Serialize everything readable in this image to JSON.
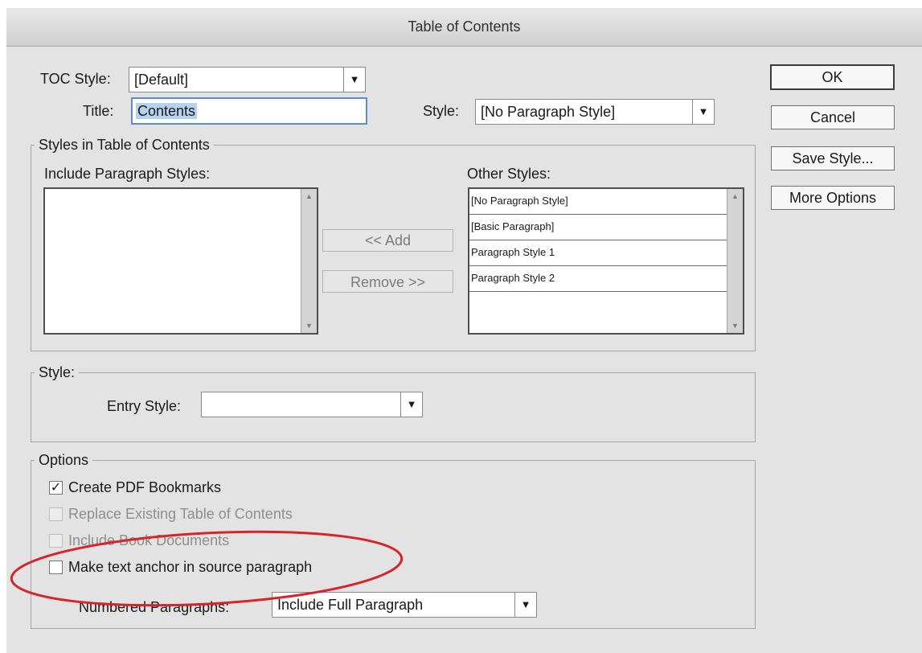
{
  "dialog": {
    "title": "Table of Contents"
  },
  "toc_style": {
    "label": "TOC Style:",
    "value": "[Default]"
  },
  "title_field": {
    "label": "Title:",
    "value": "Contents"
  },
  "title_style": {
    "label": "Style:",
    "value": "[No Paragraph Style]"
  },
  "styles_group": {
    "title": "Styles in Table of Contents",
    "include_label": "Include Paragraph Styles:",
    "include_items": [],
    "other_label": "Other Styles:",
    "other_items": [
      "[No Paragraph Style]",
      "[Basic Paragraph]",
      "Paragraph Style 1",
      "Paragraph Style 2"
    ],
    "add_button": "<< Add",
    "remove_button": "Remove >>"
  },
  "style_group": {
    "title": "Style:",
    "entry_style_label": "Entry Style:",
    "entry_style_value": ""
  },
  "options_group": {
    "title": "Options",
    "create_pdf_bookmarks": {
      "label": "Create PDF Bookmarks",
      "checked": true,
      "enabled": true
    },
    "replace_existing": {
      "label": "Replace Existing Table of Contents",
      "checked": false,
      "enabled": false
    },
    "include_book_docs": {
      "label": "Include Book Documents",
      "checked": false,
      "enabled": false
    },
    "make_text_anchor": {
      "label": "Make text anchor in source paragraph",
      "checked": false,
      "enabled": true
    },
    "numbered_paragraphs_label": "Numbered Paragraphs:",
    "numbered_paragraphs_value": "Include Full Paragraph"
  },
  "buttons": {
    "ok": "OK",
    "cancel": "Cancel",
    "save_style": "Save Style...",
    "more_options": "More Options"
  },
  "icons": {
    "dropdown_arrow": "▼",
    "scroll_up": "▲",
    "scroll_down": "▼",
    "checkmark": "✓"
  },
  "annotation": {
    "highlight_color": "#d8232a"
  }
}
